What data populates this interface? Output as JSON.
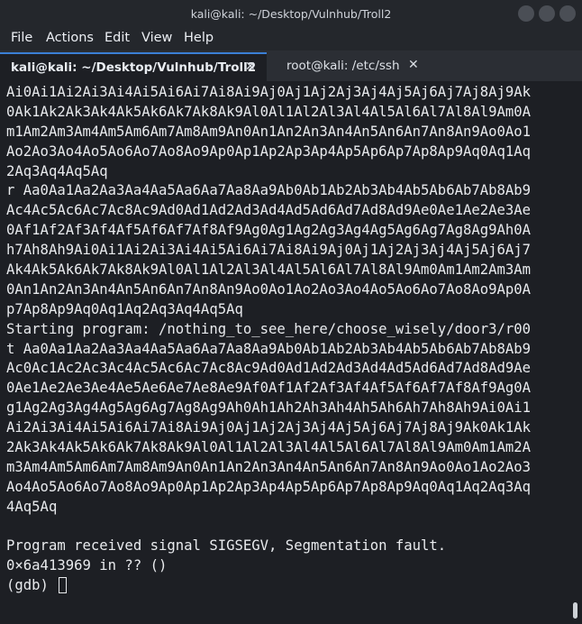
{
  "window": {
    "title": "kali@kali: ~/Desktop/Vulnhub/Troll2"
  },
  "menu": [
    "File",
    "Actions",
    "Edit",
    "View",
    "Help"
  ],
  "tabs": [
    {
      "label": "kali@kali: ~/Desktop/Vulnhub/Troll2",
      "close": "✕"
    },
    {
      "label": "root@kali: /etc/ssh",
      "close": "✕"
    }
  ],
  "terminal": {
    "lines": [
      "Ai0Ai1Ai2Ai3Ai4Ai5Ai6Ai7Ai8Ai9Aj0Aj1Aj2Aj3Aj4Aj5Aj6Aj7Aj8Aj9Ak",
      "0Ak1Ak2Ak3Ak4Ak5Ak6Ak7Ak8Ak9Al0Al1Al2Al3Al4Al5Al6Al7Al8Al9Am0A",
      "m1Am2Am3Am4Am5Am6Am7Am8Am9An0An1An2An3An4An5An6An7An8An9Ao0Ao1",
      "Ao2Ao3Ao4Ao5Ao6Ao7Ao8Ao9Ap0Ap1Ap2Ap3Ap4Ap5Ap6Ap7Ap8Ap9Aq0Aq1Aq",
      "2Aq3Aq4Aq5Aq",
      "r Aa0Aa1Aa2Aa3Aa4Aa5Aa6Aa7Aa8Aa9Ab0Ab1Ab2Ab3Ab4Ab5Ab6Ab7Ab8Ab9",
      "Ac4Ac5Ac6Ac7Ac8Ac9Ad0Ad1Ad2Ad3Ad4Ad5Ad6Ad7Ad8Ad9Ae0Ae1Ae2Ae3Ae",
      "0Af1Af2Af3Af4Af5Af6Af7Af8Af9Ag0Ag1Ag2Ag3Ag4Ag5Ag6Ag7Ag8Ag9Ah0A",
      "h7Ah8Ah9Ai0Ai1Ai2Ai3Ai4Ai5Ai6Ai7Ai8Ai9Aj0Aj1Aj2Aj3Aj4Aj5Aj6Aj7",
      "Ak4Ak5Ak6Ak7Ak8Ak9Al0Al1Al2Al3Al4Al5Al6Al7Al8Al9Am0Am1Am2Am3Am",
      "0An1An2An3An4An5An6An7An8An9Ao0Ao1Ao2Ao3Ao4Ao5Ao6Ao7Ao8Ao9Ap0A",
      "p7Ap8Ap9Aq0Aq1Aq2Aq3Aq4Aq5Aq",
      "Starting program: /nothing_to_see_here/choose_wisely/door3/r00",
      "t Aa0Aa1Aa2Aa3Aa4Aa5Aa6Aa7Aa8Aa9Ab0Ab1Ab2Ab3Ab4Ab5Ab6Ab7Ab8Ab9",
      "Ac0Ac1Ac2Ac3Ac4Ac5Ac6Ac7Ac8Ac9Ad0Ad1Ad2Ad3Ad4Ad5Ad6Ad7Ad8Ad9Ae",
      "0Ae1Ae2Ae3Ae4Ae5Ae6Ae7Ae8Ae9Af0Af1Af2Af3Af4Af5Af6Af7Af8Af9Ag0A",
      "g1Ag2Ag3Ag4Ag5Ag6Ag7Ag8Ag9Ah0Ah1Ah2Ah3Ah4Ah5Ah6Ah7Ah8Ah9Ai0Ai1",
      "Ai2Ai3Ai4Ai5Ai6Ai7Ai8Ai9Aj0Aj1Aj2Aj3Aj4Aj5Aj6Aj7Aj8Aj9Ak0Ak1Ak",
      "2Ak3Ak4Ak5Ak6Ak7Ak8Ak9Al0Al1Al2Al3Al4Al5Al6Al7Al8Al9Am0Am1Am2A",
      "m3Am4Am5Am6Am7Am8Am9An0An1An2An3An4An5An6An7An8An9Ao0Ao1Ao2Ao3",
      "Ao4Ao5Ao6Ao7Ao8Ao9Ap0Ap1Ap2Ap3Ap4Ap5Ap6Ap7Ap8Ap9Aq0Aq1Aq2Aq3Aq",
      "4Aq5Aq",
      "",
      "Program received signal SIGSEGV, Segmentation fault.",
      "0×6a413969 in ?? ()"
    ],
    "prompt": "(gdb) "
  },
  "colors": {
    "background": "#1d1f24",
    "text": "#e8eaed",
    "active_tab_accent": "#3b7fd6"
  }
}
